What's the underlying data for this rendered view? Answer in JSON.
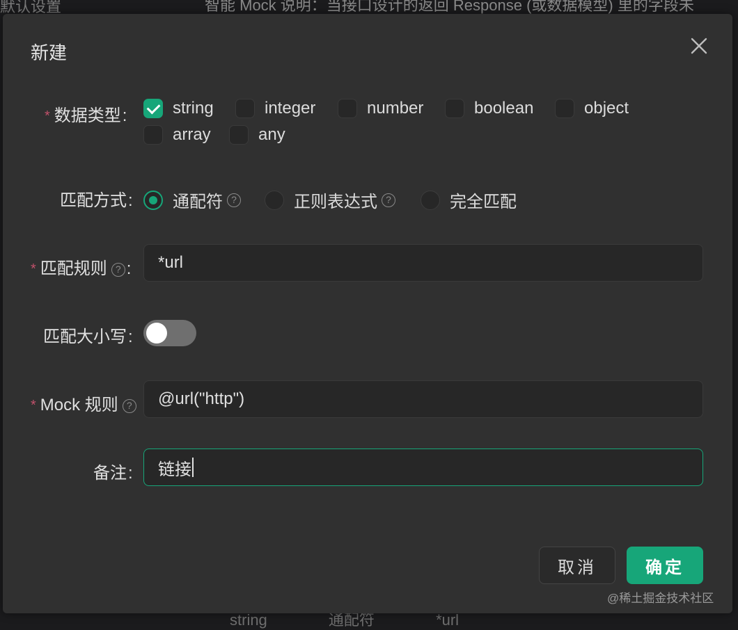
{
  "background": {
    "top_left_text": "默认设置",
    "top_desc_text": "智能 Mock 说明：当接口设计的返回 Response (或数据模型) 里的字段未",
    "bottom_row": [
      "string",
      "通配符",
      "*url"
    ]
  },
  "dialog": {
    "title": "新建",
    "fields": {
      "data_type": {
        "label": "数据类型",
        "required": true,
        "options": [
          "string",
          "integer",
          "number",
          "boolean",
          "object",
          "array",
          "any"
        ],
        "checked": [
          "string"
        ]
      },
      "match_mode": {
        "label": "匹配方式",
        "options": [
          "通配符",
          "正则表达式",
          "完全匹配"
        ],
        "selected": "通配符"
      },
      "match_rule": {
        "label": "匹配规则",
        "required": true,
        "value": "*url"
      },
      "case_sensitive": {
        "label": "匹配大小写",
        "on": false
      },
      "mock_rule": {
        "label": "Mock 规则",
        "required": true,
        "value": "@url(\"http\")"
      },
      "remark": {
        "label": "备注",
        "value": "链接"
      }
    },
    "buttons": {
      "cancel": "取消",
      "ok": "确定"
    }
  },
  "watermark": "@稀土掘金技术社区",
  "colors": {
    "accent": "#17a679",
    "required": "#c0506a",
    "dialog_bg": "#303030"
  },
  "icons": {
    "close": "close-icon",
    "help": "question-circle-icon",
    "check": "check-icon"
  }
}
